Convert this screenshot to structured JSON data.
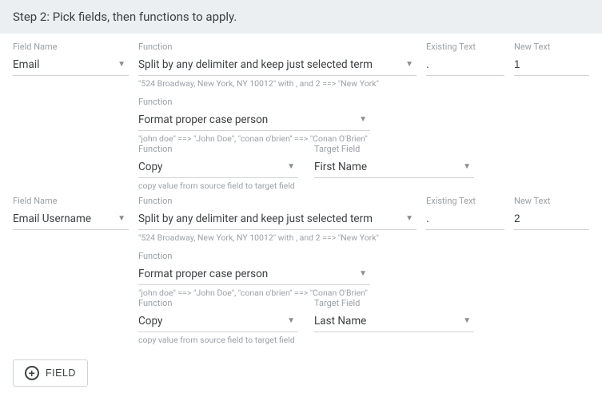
{
  "header": {
    "title": "Step 2: Pick fields, then functions to apply."
  },
  "labels": {
    "field_name": "Field Name",
    "function": "Function",
    "existing_text": "Existing Text",
    "new_text": "New Text",
    "target_field": "Target Field"
  },
  "groups": [
    {
      "field": "Email",
      "fn1": "Split by any delimiter and keep just selected term",
      "existing": ".",
      "new": "1",
      "help1": "\"524 Broadway, New York, NY 10012\" with , and 2 ==> \"New York\"",
      "fn2": "Format proper case person",
      "help2": "\"john doe\" ==> \"John Doe\", \"conan o'brien\" ==> \"Conan O'Brien\"",
      "fn3": "Copy",
      "target": "First Name",
      "help3": "copy value from source field to target field"
    },
    {
      "field": "Email Username",
      "fn1": "Split by any delimiter and keep just selected term",
      "existing": ".",
      "new": "2",
      "help1": "\"524 Broadway, New York, NY 10012\" with , and 2 ==> \"New York\"",
      "fn2": "Format proper case person",
      "help2": "\"john doe\" ==> \"John Doe\", \"conan o'brien\" ==> \"Conan O'Brien\"",
      "fn3": "Copy",
      "target": "Last Name",
      "help3": "copy value from source field to target field"
    }
  ],
  "add_button": "FIELD"
}
